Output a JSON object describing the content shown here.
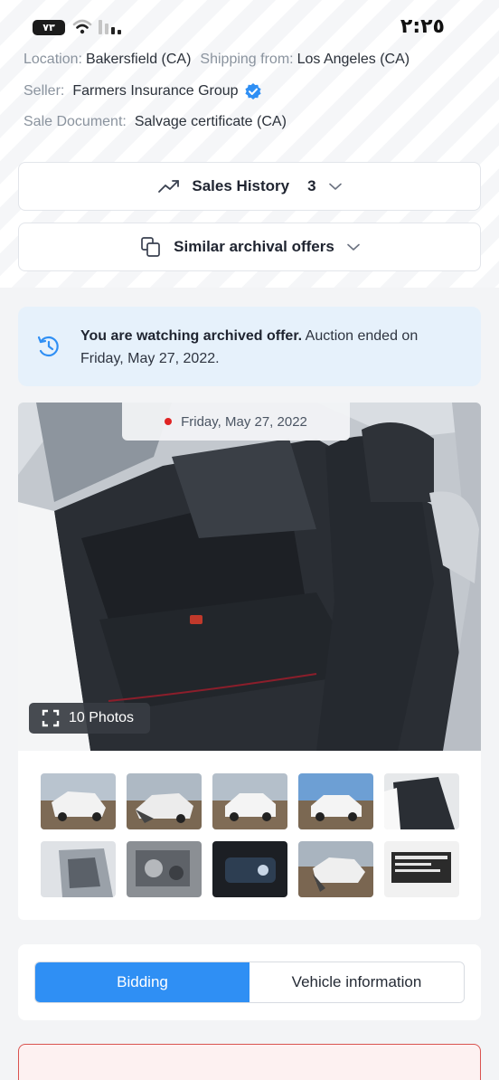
{
  "status_bar": {
    "battery": "٧٣",
    "time": "٢:٢٥"
  },
  "details": {
    "location_label": "Location:",
    "location_value": "Bakersfield (CA)",
    "shipping_label": "Shipping from:",
    "shipping_value": "Los Angeles (CA)",
    "seller_label": "Seller:",
    "seller_value": "Farmers Insurance Group",
    "document_label": "Sale Document:",
    "document_value": "Salvage certificate (CA)"
  },
  "sales_history": {
    "label": "Sales History",
    "count": "3",
    "icon": "trending-up-icon"
  },
  "similar_offers": {
    "label": "Similar archival offers",
    "icon": "copy-icon"
  },
  "notice": {
    "bold": "You are watching archived offer.",
    "text": " Auction ended on Friday, May 27, 2022.",
    "icon": "history-icon"
  },
  "gallery": {
    "date": "Friday, May 27, 2022",
    "photos_label": "10 Photos"
  },
  "tabs": {
    "bidding": "Bidding",
    "vehicle_info": "Vehicle information"
  },
  "colors": {
    "accent": "#2f8ff4",
    "notice_bg": "#e6f1fb",
    "alert_border": "#d9534f"
  }
}
